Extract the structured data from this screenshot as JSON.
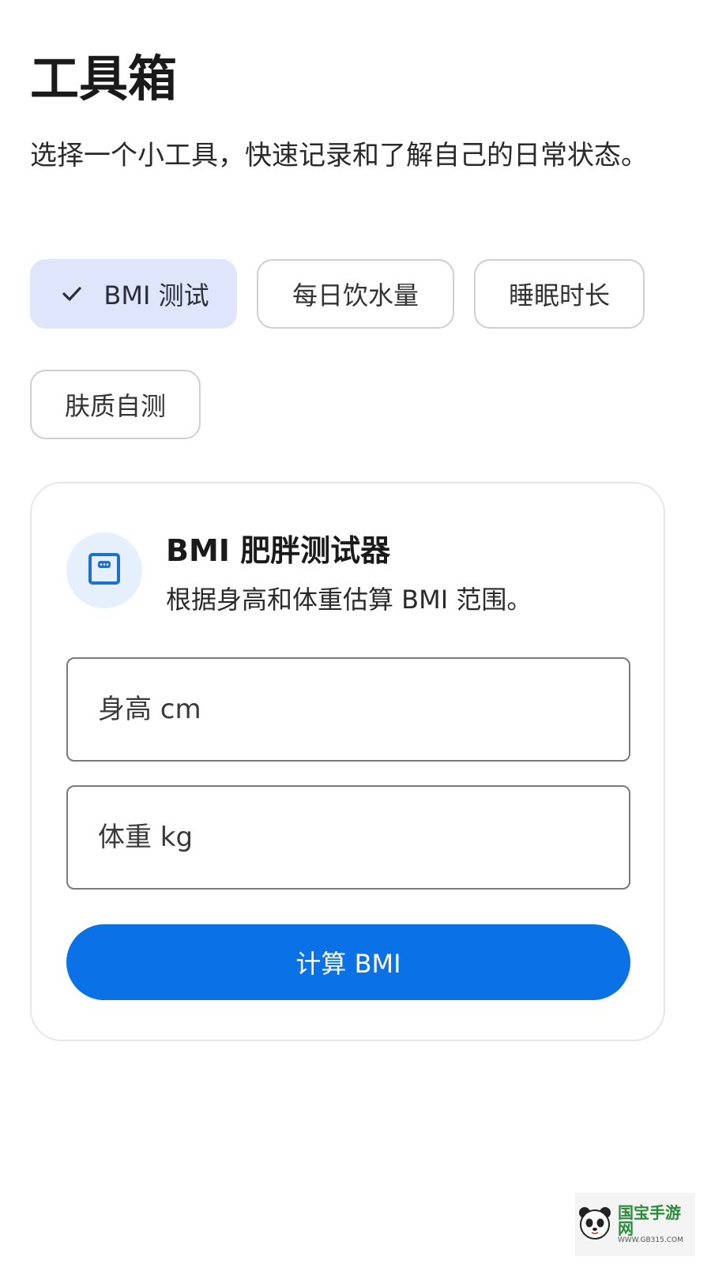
{
  "header": {
    "title": "工具箱",
    "subtitle": "选择一个小工具，快速记录和了解自己的日常状态。"
  },
  "tabs": [
    {
      "label": "BMI 测试",
      "selected": true
    },
    {
      "label": "每日饮水量",
      "selected": false
    },
    {
      "label": "睡眠时长",
      "selected": false
    },
    {
      "label": "肤质自测",
      "selected": false
    }
  ],
  "card": {
    "icon": "scale-icon",
    "title": "BMI 肥胖测试器",
    "description": "根据身高和体重估算 BMI 范围。",
    "height_placeholder": "身高 cm",
    "weight_placeholder": "体重 kg",
    "submit_label": "计算 BMI"
  },
  "watermark": {
    "icon": "panda-logo-icon",
    "brand": "国宝手游网",
    "site": "WWW.GB315.COM"
  },
  "colors": {
    "accent": "#0a72e6",
    "selected_chip": "#dfe6fb",
    "icon_bg": "#e6effc"
  }
}
